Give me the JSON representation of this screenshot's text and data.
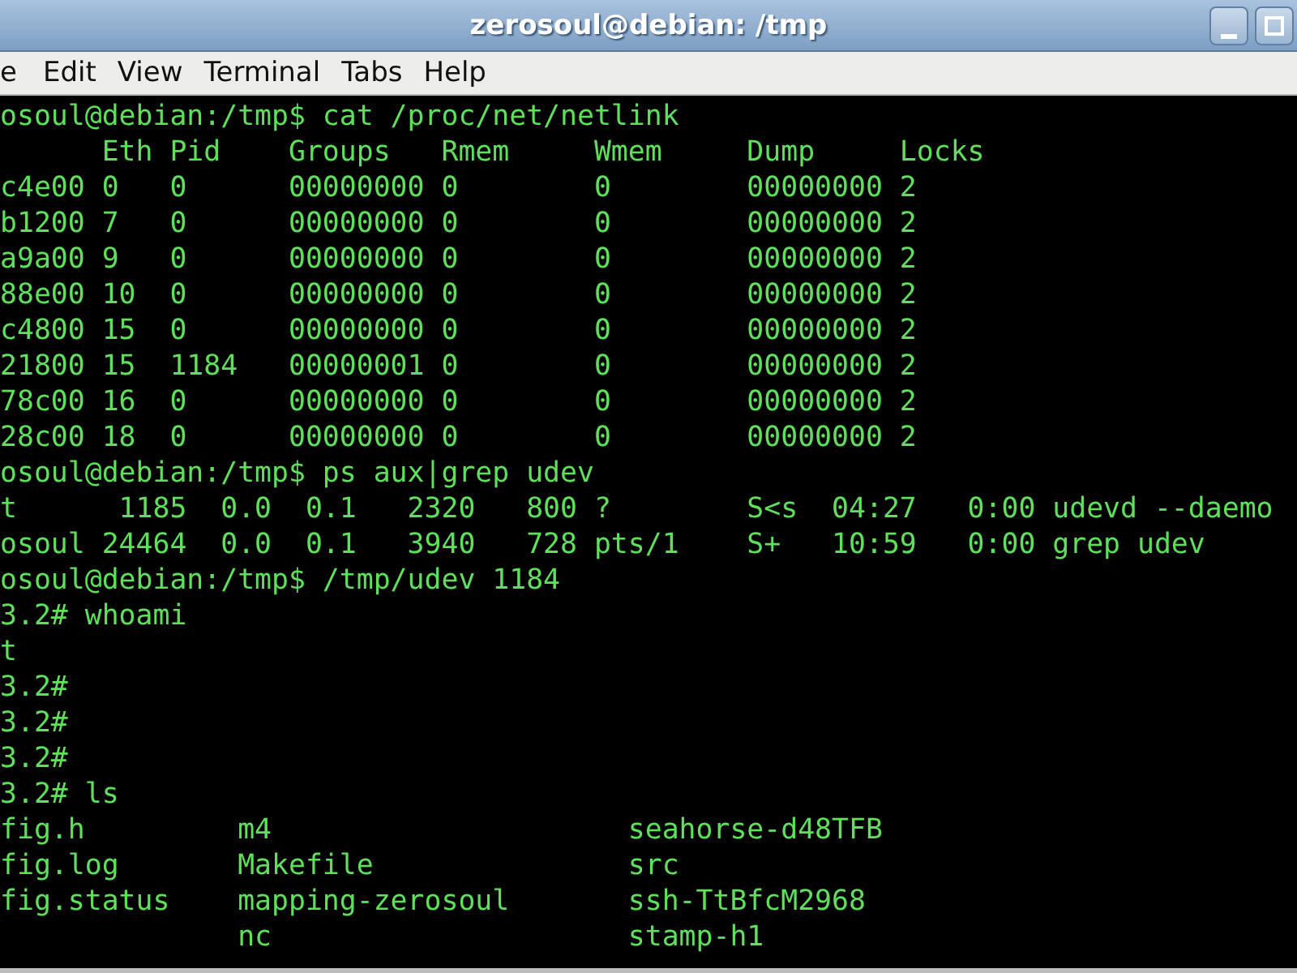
{
  "window": {
    "title": "zerosoul@debian: /tmp"
  },
  "menu": [
    {
      "label": "e"
    },
    {
      "label": "Edit"
    },
    {
      "label": "View"
    },
    {
      "label": "Terminal"
    },
    {
      "label": "Tabs"
    },
    {
      "label": "Help"
    }
  ],
  "terminal": {
    "blocks": [
      {
        "kind": "line",
        "text": "osoul@debian:/tmp$ cat /proc/net/netlink"
      },
      {
        "kind": "line",
        "text": "      Eth Pid    Groups   Rmem     Wmem     Dump     Locks"
      },
      {
        "kind": "line",
        "text": "c4e00 0   0      00000000 0        0        00000000 2"
      },
      {
        "kind": "line",
        "text": "b1200 7   0      00000000 0        0        00000000 2"
      },
      {
        "kind": "line",
        "text": "a9a00 9   0      00000000 0        0        00000000 2"
      },
      {
        "kind": "line",
        "text": "88e00 10  0      00000000 0        0        00000000 2"
      },
      {
        "kind": "line",
        "text": "c4800 15  0      00000000 0        0        00000000 2"
      },
      {
        "kind": "line",
        "text": "21800 15  1184   00000001 0        0        00000000 2"
      },
      {
        "kind": "line",
        "text": "78c00 16  0      00000000 0        0        00000000 2"
      },
      {
        "kind": "line",
        "text": "28c00 18  0      00000000 0        0        00000000 2"
      },
      {
        "kind": "line",
        "text": "osoul@debian:/tmp$ ps aux|grep udev"
      },
      {
        "kind": "line",
        "text": "t      1185  0.0  0.1   2320   800 ?        S<s  04:27   0:00 udevd --daemo"
      },
      {
        "kind": "line",
        "text": "osoul 24464  0.0  0.1   3940   728 pts/1    S+   10:59   0:00 grep udev"
      },
      {
        "kind": "line",
        "text": "osoul@debian:/tmp$ /tmp/udev 1184"
      },
      {
        "kind": "line",
        "text": "3.2# whoami"
      },
      {
        "kind": "line",
        "text": "t"
      },
      {
        "kind": "line",
        "text": "3.2#"
      },
      {
        "kind": "line",
        "text": "3.2#"
      },
      {
        "kind": "line",
        "text": "3.2#"
      },
      {
        "kind": "line",
        "text": "3.2# ls"
      },
      {
        "kind": "columns",
        "columns": [
          [
            "fig.h",
            "fig.log",
            "fig.status"
          ],
          [
            "m4",
            "Makefile",
            "mapping-zerosoul",
            "nc"
          ],
          [
            "seahorse-d48TFB",
            "src",
            "ssh-TtBfcM2968",
            "stamp-h1"
          ]
        ]
      }
    ]
  }
}
